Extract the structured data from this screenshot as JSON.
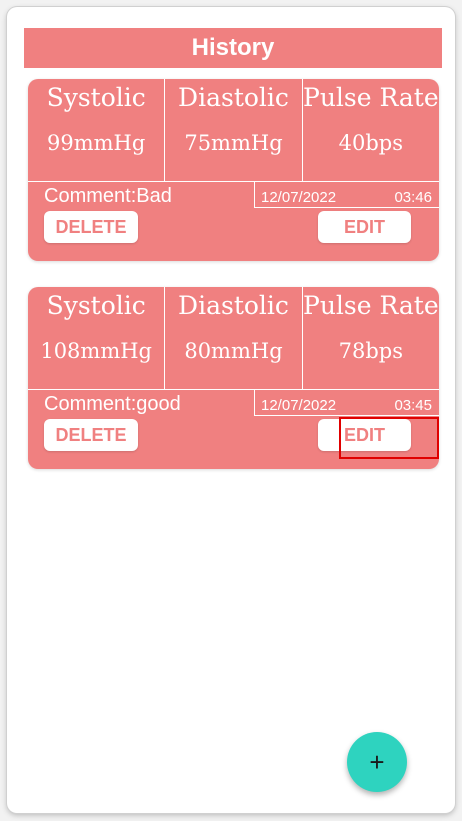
{
  "header": {
    "title": "History"
  },
  "records": [
    {
      "systolic_label": "Systolic",
      "systolic_value": "99mmHg",
      "diastolic_label": "Diastolic",
      "diastolic_value": "75mmHg",
      "pulse_label": "Pulse Rate",
      "pulse_value": "40bps",
      "comment": "Comment:Bad",
      "date": "12/07/2022",
      "time": "03:46",
      "delete_label": "DELETE",
      "edit_label": "EDIT"
    },
    {
      "systolic_label": "Systolic",
      "systolic_value": "108mmHg",
      "diastolic_label": "Diastolic",
      "diastolic_value": "80mmHg",
      "pulse_label": "Pulse Rate",
      "pulse_value": "78bps",
      "comment": "Comment:good",
      "date": "12/07/2022",
      "time": "03:45",
      "delete_label": "DELETE",
      "edit_label": "EDIT"
    }
  ],
  "fab": {
    "label": "+",
    "icon": "plus-icon"
  },
  "colors": {
    "accent": "#f08080",
    "fab": "#2ed3bf",
    "highlight": "#e00000"
  }
}
